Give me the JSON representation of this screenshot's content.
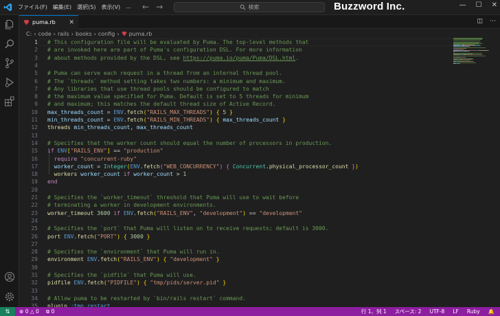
{
  "titlebar": {
    "menu": [
      "ファイル(F)",
      "編集(E)",
      "選択(S)",
      "表示(V)",
      "..."
    ],
    "search_placeholder": "検索",
    "watermark": "Buzzword Inc."
  },
  "tab": {
    "label": "puma.rb"
  },
  "breadcrumb": [
    "C:",
    "code",
    "rails",
    "books",
    "config",
    "puma.rb"
  ],
  "editor": {
    "lines": [
      {
        "n": "1",
        "segs": [
          {
            "t": "# This configuration file will be evaluated by Puma. The top-level methods that",
            "c": "comment"
          }
        ]
      },
      {
        "n": "2",
        "segs": [
          {
            "t": "# are invoked here are part of Puma's configuration DSL. For more information",
            "c": "comment"
          }
        ]
      },
      {
        "n": "3",
        "segs": [
          {
            "t": "# about methods provided by the DSL, see ",
            "c": "comment"
          },
          {
            "t": "https://puma.io/puma/Puma/DSL.html",
            "c": "link"
          },
          {
            "t": ".",
            "c": "comment"
          }
        ]
      },
      {
        "n": "4",
        "segs": []
      },
      {
        "n": "5",
        "segs": [
          {
            "t": "# Puma can serve each request in a thread from an internal thread pool.",
            "c": "comment"
          }
        ]
      },
      {
        "n": "6",
        "segs": [
          {
            "t": "# The `threads` method setting takes two numbers: a minimum and maximum.",
            "c": "comment"
          }
        ]
      },
      {
        "n": "7",
        "segs": [
          {
            "t": "# Any libraries that use thread pools should be configured to match",
            "c": "comment"
          }
        ]
      },
      {
        "n": "8",
        "segs": [
          {
            "t": "# the maximum value specified for Puma. Default is set to 5 threads for minimum",
            "c": "comment"
          }
        ]
      },
      {
        "n": "9",
        "segs": [
          {
            "t": "# and maximum; this matches the default thread size of Active Record.",
            "c": "comment"
          }
        ]
      },
      {
        "n": "10",
        "segs": [
          {
            "t": "max_threads_count",
            "c": "ivar"
          },
          {
            "t": " = ",
            "c": "op"
          },
          {
            "t": "ENV",
            "c": "kw"
          },
          {
            "t": ".",
            "c": "op"
          },
          {
            "t": "fetch",
            "c": "fn"
          },
          {
            "t": "(",
            "c": "br1"
          },
          {
            "t": "\"RAILS_MAX_THREADS\"",
            "c": "str"
          },
          {
            "t": ")",
            "c": "br1"
          },
          {
            "t": " ",
            "c": "op"
          },
          {
            "t": "{",
            "c": "br1"
          },
          {
            "t": " ",
            "c": "op"
          },
          {
            "t": "5",
            "c": "num"
          },
          {
            "t": " ",
            "c": "op"
          },
          {
            "t": "}",
            "c": "br1"
          }
        ]
      },
      {
        "n": "11",
        "segs": [
          {
            "t": "min_threads_count",
            "c": "ivar"
          },
          {
            "t": " = ",
            "c": "op"
          },
          {
            "t": "ENV",
            "c": "kw"
          },
          {
            "t": ".",
            "c": "op"
          },
          {
            "t": "fetch",
            "c": "fn"
          },
          {
            "t": "(",
            "c": "br1"
          },
          {
            "t": "\"RAILS_MIN_THREADS\"",
            "c": "str"
          },
          {
            "t": ")",
            "c": "br1"
          },
          {
            "t": " ",
            "c": "op"
          },
          {
            "t": "{",
            "c": "br1"
          },
          {
            "t": " max_threads_count ",
            "c": "ivar"
          },
          {
            "t": "}",
            "c": "br1"
          }
        ]
      },
      {
        "n": "12",
        "segs": [
          {
            "t": "threads",
            "c": "fn"
          },
          {
            "t": " min_threads_count, max_threads_count",
            "c": "ivar"
          }
        ]
      },
      {
        "n": "13",
        "segs": []
      },
      {
        "n": "14",
        "segs": [
          {
            "t": "# Specifies that the worker count should equal the number of processors in production.",
            "c": "comment"
          }
        ]
      },
      {
        "n": "15",
        "segs": [
          {
            "t": "if",
            "c": "ctl"
          },
          {
            "t": " ",
            "c": "op"
          },
          {
            "t": "ENV",
            "c": "kw"
          },
          {
            "t": "[",
            "c": "br1"
          },
          {
            "t": "\"RAILS_ENV\"",
            "c": "str"
          },
          {
            "t": "]",
            "c": "br1"
          },
          {
            "t": " == ",
            "c": "op"
          },
          {
            "t": "\"production\"",
            "c": "str"
          }
        ]
      },
      {
        "n": "16",
        "segs": [
          {
            "t": "  "
          },
          {
            "t": "require",
            "c": "ctl"
          },
          {
            "t": " ",
            "c": "op"
          },
          {
            "t": "\"concurrent-ruby\"",
            "c": "str"
          }
        ]
      },
      {
        "n": "17",
        "segs": [
          {
            "t": "  worker_count",
            "c": "ivar"
          },
          {
            "t": " = ",
            "c": "op"
          },
          {
            "t": "Integer",
            "c": "const"
          },
          {
            "t": "(",
            "c": "br1"
          },
          {
            "t": "ENV",
            "c": "kw"
          },
          {
            "t": ".",
            "c": "op"
          },
          {
            "t": "fetch",
            "c": "fn"
          },
          {
            "t": "(",
            "c": "br2"
          },
          {
            "t": "\"WEB_CONCURRENCY\"",
            "c": "str"
          },
          {
            "t": ")",
            "c": "br2"
          },
          {
            "t": " ",
            "c": "op"
          },
          {
            "t": "{",
            "c": "br2"
          },
          {
            "t": " ",
            "c": "op"
          },
          {
            "t": "Concurrent",
            "c": "const"
          },
          {
            "t": ".",
            "c": "op"
          },
          {
            "t": "physical_processor_count",
            "c": "fn"
          },
          {
            "t": " ",
            "c": "op"
          },
          {
            "t": "}",
            "c": "br2"
          },
          {
            "t": ")",
            "c": "br1"
          }
        ]
      },
      {
        "n": "18",
        "segs": [
          {
            "t": "  "
          },
          {
            "t": "workers",
            "c": "fn"
          },
          {
            "t": " worker_count ",
            "c": "ivar"
          },
          {
            "t": "if",
            "c": "ctl"
          },
          {
            "t": " worker_count",
            "c": "ivar"
          },
          {
            "t": " > ",
            "c": "op"
          },
          {
            "t": "1",
            "c": "num"
          }
        ]
      },
      {
        "n": "19",
        "segs": [
          {
            "t": "end",
            "c": "ctl"
          }
        ]
      },
      {
        "n": "20",
        "segs": []
      },
      {
        "n": "21",
        "segs": [
          {
            "t": "# Specifies the `worker_timeout` threshold that Puma will use to wait before",
            "c": "comment"
          }
        ]
      },
      {
        "n": "22",
        "segs": [
          {
            "t": "# terminating a worker in development environments.",
            "c": "comment"
          }
        ]
      },
      {
        "n": "23",
        "segs": [
          {
            "t": "worker_timeout",
            "c": "fn"
          },
          {
            "t": " ",
            "c": "op"
          },
          {
            "t": "3600",
            "c": "num"
          },
          {
            "t": " ",
            "c": "op"
          },
          {
            "t": "if",
            "c": "ctl"
          },
          {
            "t": " ",
            "c": "op"
          },
          {
            "t": "ENV",
            "c": "kw"
          },
          {
            "t": ".",
            "c": "op"
          },
          {
            "t": "fetch",
            "c": "fn"
          },
          {
            "t": "(",
            "c": "br1"
          },
          {
            "t": "\"RAILS_ENV\"",
            "c": "str"
          },
          {
            "t": ", ",
            "c": "op"
          },
          {
            "t": "\"development\"",
            "c": "str"
          },
          {
            "t": ")",
            "c": "br1"
          },
          {
            "t": " == ",
            "c": "op"
          },
          {
            "t": "\"development\"",
            "c": "str"
          }
        ]
      },
      {
        "n": "24",
        "segs": []
      },
      {
        "n": "25",
        "segs": [
          {
            "t": "# Specifies the `port` that Puma will listen on to receive requests; default is 3000.",
            "c": "comment"
          }
        ]
      },
      {
        "n": "26",
        "segs": [
          {
            "t": "port",
            "c": "fn"
          },
          {
            "t": " ",
            "c": "op"
          },
          {
            "t": "ENV",
            "c": "kw"
          },
          {
            "t": ".",
            "c": "op"
          },
          {
            "t": "fetch",
            "c": "fn"
          },
          {
            "t": "(",
            "c": "br1"
          },
          {
            "t": "\"PORT\"",
            "c": "str"
          },
          {
            "t": ")",
            "c": "br1"
          },
          {
            "t": " ",
            "c": "op"
          },
          {
            "t": "{",
            "c": "br1"
          },
          {
            "t": " ",
            "c": "op"
          },
          {
            "t": "3000",
            "c": "num"
          },
          {
            "t": " ",
            "c": "op"
          },
          {
            "t": "}",
            "c": "br1"
          }
        ]
      },
      {
        "n": "27",
        "segs": []
      },
      {
        "n": "28",
        "segs": [
          {
            "t": "# Specifies the `environment` that Puma will run in.",
            "c": "comment"
          }
        ]
      },
      {
        "n": "29",
        "segs": [
          {
            "t": "environment",
            "c": "fn"
          },
          {
            "t": " ",
            "c": "op"
          },
          {
            "t": "ENV",
            "c": "kw"
          },
          {
            "t": ".",
            "c": "op"
          },
          {
            "t": "fetch",
            "c": "fn"
          },
          {
            "t": "(",
            "c": "br1"
          },
          {
            "t": "\"RAILS_ENV\"",
            "c": "str"
          },
          {
            "t": ")",
            "c": "br1"
          },
          {
            "t": " ",
            "c": "op"
          },
          {
            "t": "{",
            "c": "br1"
          },
          {
            "t": " ",
            "c": "op"
          },
          {
            "t": "\"development\"",
            "c": "str"
          },
          {
            "t": " ",
            "c": "op"
          },
          {
            "t": "}",
            "c": "br1"
          }
        ]
      },
      {
        "n": "30",
        "segs": []
      },
      {
        "n": "31",
        "segs": [
          {
            "t": "# Specifies the `pidfile` that Puma will use.",
            "c": "comment"
          }
        ]
      },
      {
        "n": "32",
        "segs": [
          {
            "t": "pidfile",
            "c": "fn"
          },
          {
            "t": " ",
            "c": "op"
          },
          {
            "t": "ENV",
            "c": "kw"
          },
          {
            "t": ".",
            "c": "op"
          },
          {
            "t": "fetch",
            "c": "fn"
          },
          {
            "t": "(",
            "c": "br1"
          },
          {
            "t": "\"PIDFILE\"",
            "c": "str"
          },
          {
            "t": ")",
            "c": "br1"
          },
          {
            "t": " ",
            "c": "op"
          },
          {
            "t": "{",
            "c": "br1"
          },
          {
            "t": " ",
            "c": "op"
          },
          {
            "t": "\"tmp/pids/server.pid\"",
            "c": "str"
          },
          {
            "t": " ",
            "c": "op"
          },
          {
            "t": "}",
            "c": "br1"
          }
        ]
      },
      {
        "n": "33",
        "segs": []
      },
      {
        "n": "34",
        "segs": [
          {
            "t": "# Allow puma to be restarted by `bin/rails restart` command.",
            "c": "comment"
          }
        ]
      },
      {
        "n": "35",
        "segs": [
          {
            "t": "plugin",
            "c": "fn"
          },
          {
            "t": " ",
            "c": "op"
          },
          {
            "t": ":tmp_restart",
            "c": "kw"
          }
        ]
      }
    ]
  },
  "statusbar": {
    "errors": "0",
    "warnings": "0",
    "ports": "0",
    "position": "行 1、列 1",
    "spaces": "スペース: 2",
    "encoding": "UTF-8",
    "eol": "LF",
    "language": "Ruby"
  },
  "colors": {
    "statusbar_bg": "#8e1ea0",
    "remote_bg": "#16825d",
    "editor_bg": "#1f1f1f",
    "accent": "#0078d4"
  }
}
